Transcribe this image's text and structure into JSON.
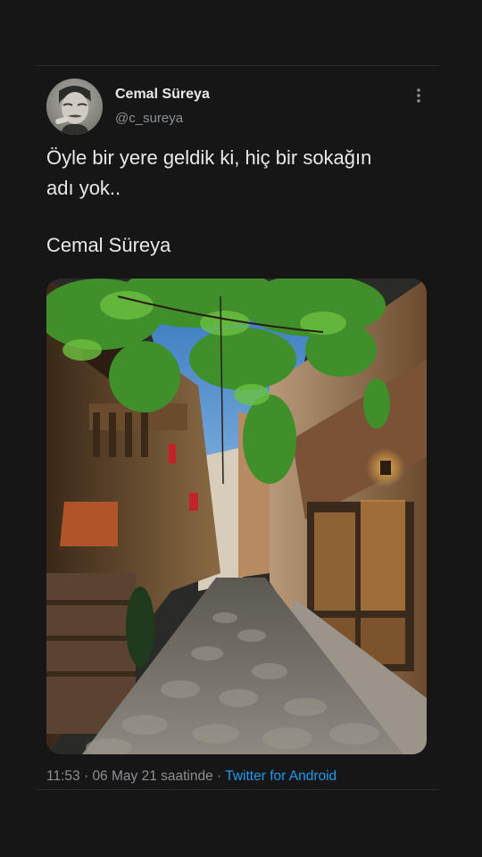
{
  "tweet": {
    "author": {
      "display_name": "Cemal Süreya",
      "handle": "@c_sureya",
      "avatar_icon": "avatar-photo"
    },
    "more_icon": "more-vertical-icon",
    "text_lines": [
      "Öyle bir yere geldik ki, hiç bir sokağın",
      "adı yok..",
      "Cemal Süreya"
    ],
    "media_description_icon": "cobblestone-street-photo",
    "time": "11:53",
    "separator": "·",
    "date": "06 May 21 saatinde",
    "source": "Twitter for Android"
  },
  "colors": {
    "background": "#161616",
    "text": "#e7e9ea",
    "secondary_text": "#8b9096",
    "link": "#1d9bf0",
    "divider": "#2a2b2d"
  }
}
